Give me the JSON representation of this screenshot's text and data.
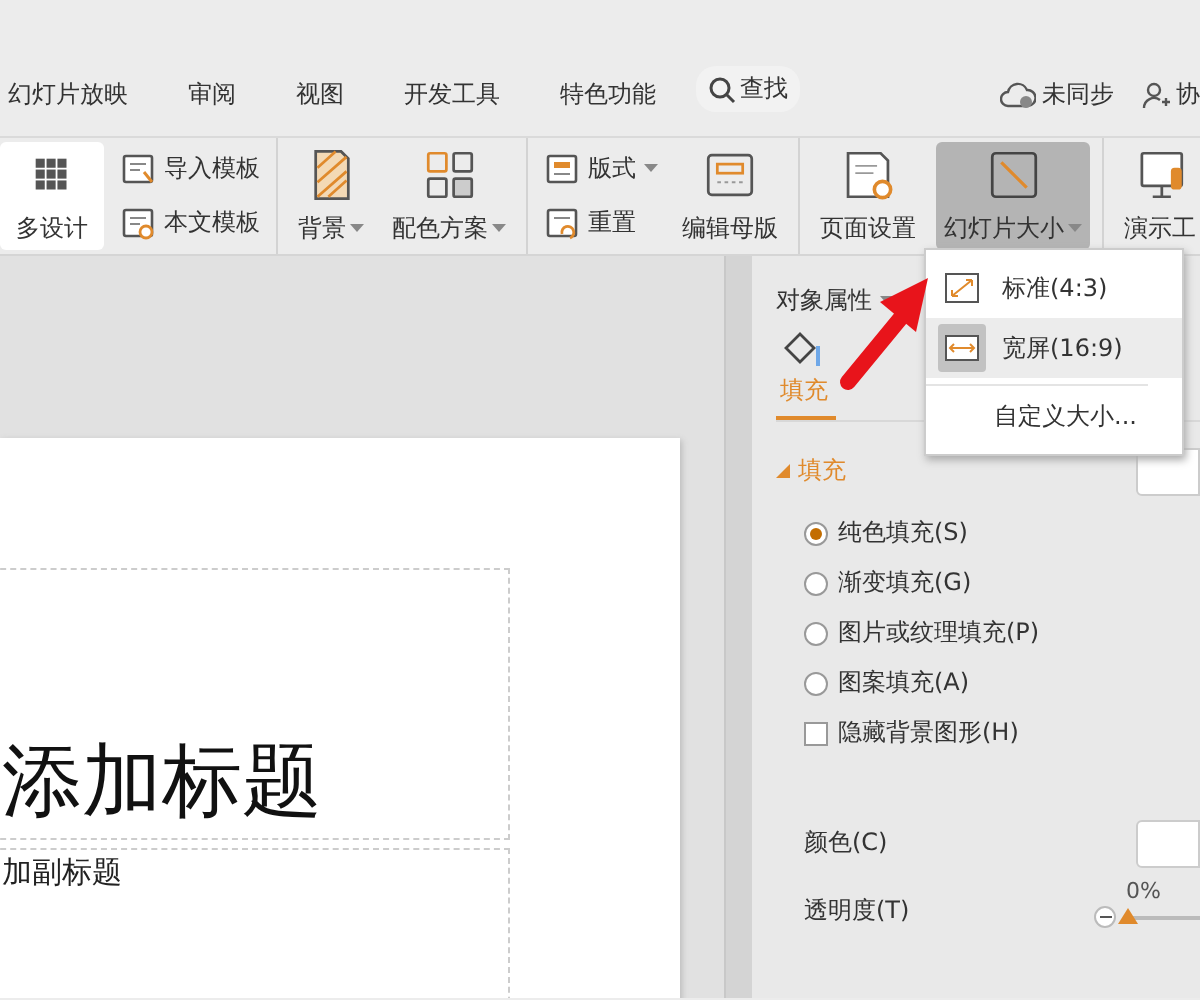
{
  "menu": [
    {
      "label": "幻灯片放映"
    },
    {
      "label": "审阅"
    },
    {
      "label": "视图"
    },
    {
      "label": "开发工具"
    },
    {
      "label": "特色功能"
    }
  ],
  "search": {
    "label": "查找"
  },
  "sync": {
    "label": "未同步"
  },
  "collab": {
    "label": "协"
  },
  "ribbon": [
    {
      "items": [
        {
          "kind": "large",
          "label": "多设计",
          "dropdown": false,
          "selected": false
        },
        {
          "kind": "stack",
          "children": [
            {
              "label": "导入模板",
              "dropdown": false
            },
            {
              "label": "本文模板",
              "dropdown": false
            }
          ]
        }
      ]
    },
    {
      "items": [
        {
          "kind": "large",
          "label": "背景",
          "dropdown": true,
          "selected": false
        },
        {
          "kind": "large",
          "label": "配色方案",
          "dropdown": true,
          "selected": false
        }
      ]
    },
    {
      "items": [
        {
          "kind": "stack",
          "children": [
            {
              "label": "版式",
              "dropdown": true
            },
            {
              "label": "重置",
              "dropdown": false
            }
          ]
        },
        {
          "kind": "large",
          "label": "编辑母版",
          "dropdown": false,
          "selected": false
        }
      ]
    },
    {
      "items": [
        {
          "kind": "large",
          "label": "页面设置",
          "dropdown": false,
          "selected": false
        },
        {
          "kind": "large",
          "label": "幻灯片大小",
          "dropdown": true,
          "selected": true
        }
      ]
    },
    {
      "items": [
        {
          "kind": "large",
          "label": "演示工",
          "dropdown": false,
          "selected": false
        }
      ]
    }
  ],
  "size_menu": [
    {
      "kind": "icon",
      "label": "标准(4:3)",
      "selected": false
    },
    {
      "kind": "icon",
      "label": "宽屏(16:9)",
      "selected": true
    },
    {
      "kind": "text",
      "label": "自定义大小...",
      "selected": false
    }
  ],
  "slide": {
    "title": "添加标题",
    "subtitle": "加副标题"
  },
  "panel": {
    "header": "对象属性",
    "tab": "填充",
    "section": "填充",
    "options": [
      {
        "kind": "radio",
        "label": "纯色填充(S)",
        "selected": true
      },
      {
        "kind": "radio",
        "label": "渐变填充(G)",
        "selected": false
      },
      {
        "kind": "radio",
        "label": "图片或纹理填充(P)",
        "selected": false
      },
      {
        "kind": "radio",
        "label": "图案填充(A)",
        "selected": false
      },
      {
        "kind": "checkbox",
        "label": "隐藏背景图形(H)",
        "checked": false
      }
    ],
    "color_label": "颜色(C)",
    "transparency": {
      "label": "透明度(T)",
      "value": "0%",
      "level": 0
    }
  }
}
